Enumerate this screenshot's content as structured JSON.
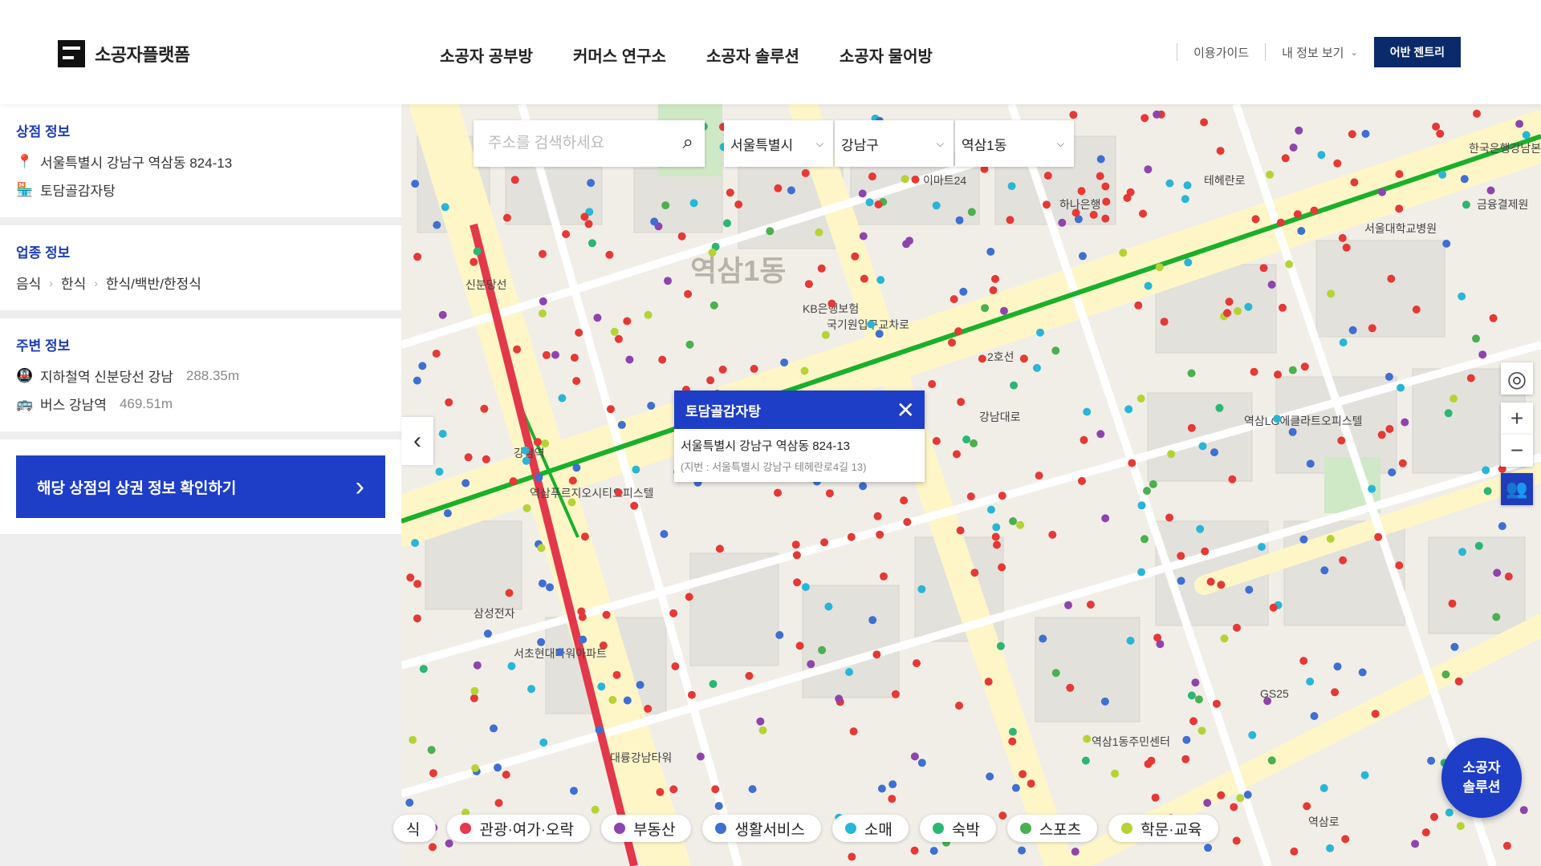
{
  "header": {
    "logo_text": "소공자플랫폼",
    "nav": [
      "소공자 공부방",
      "커머스 연구소",
      "소공자 솔루션",
      "소공자 물어방"
    ],
    "guide": "이용가이드",
    "my_info": "내 정보 보기",
    "brand_button": "어반 젠트리"
  },
  "sidebar": {
    "store_title": "상점 정보",
    "store_address": "서울특별시 강남구 역삼동 824-13",
    "store_name": "토담골감자탕",
    "industry_title": "업종 정보",
    "industry_path": [
      "음식",
      "한식",
      "한식/백반/한정식"
    ],
    "nearby_title": "주변 정보",
    "subway_label": "지하철역 신분당선 강남",
    "subway_distance": "288.35m",
    "bus_label": "버스 강남역",
    "bus_distance": "469.51m",
    "cta_label": "해당 상점의 상권 정보 확인하기",
    "icons": [
      "location-pin-icon",
      "store-icon",
      "subway-icon",
      "bus-icon"
    ]
  },
  "map": {
    "search_placeholder": "주소를 검색하세요",
    "city": "서울특별시",
    "district": "강남구",
    "dong": "역삼1동",
    "watermark": "역삼1동",
    "popup": {
      "title": "토담골감자탕",
      "address": "서울특별시 강남구 역삼동 824-13",
      "lot_address": "(지번 : 서울특별시 강남구 테헤란로4길 13)"
    },
    "fab_line1": "소공자",
    "fab_line2": "솔루션",
    "legend": [
      {
        "label": "식",
        "color": "#e53935"
      },
      {
        "label": "관광·여가·오락",
        "color": "#e53950"
      },
      {
        "label": "부동산",
        "color": "#8e44ad"
      },
      {
        "label": "생활서비스",
        "color": "#3f6fd1"
      },
      {
        "label": "소매",
        "color": "#29b6d6"
      },
      {
        "label": "숙박",
        "color": "#2bb673"
      },
      {
        "label": "스포츠",
        "color": "#4caf50"
      },
      {
        "label": "학문·교육",
        "color": "#b5d334"
      }
    ],
    "labels": [
      "이마트24",
      "하나은행",
      "KB은행보험",
      "국기원입구교차로",
      "강남역",
      "신분당선",
      "삼성전자",
      "서초현대타워아파트",
      "대륭강남타워",
      "역삼푸르지오시티오피스텔",
      "역삼LG에클라트오피스텔",
      "한국은행강남본부",
      "금융결제원",
      "서울대학교병원",
      "GS25",
      "역삼1동주민센터",
      "테헤란로",
      "역삼로",
      "2호선",
      "강남대로"
    ]
  }
}
